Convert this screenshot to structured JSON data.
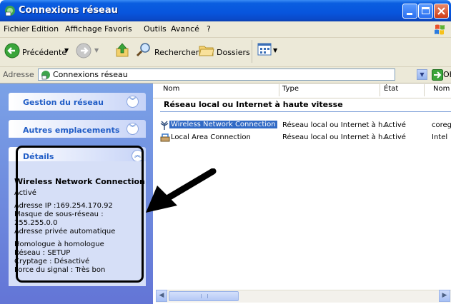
{
  "window": {
    "title": "Connexions réseau",
    "accent": "#0855dd",
    "close_color": "#cf3c16"
  },
  "menu": [
    "Fichier",
    "Edition",
    "Affichage",
    "Favoris",
    "Outils",
    "Avancé",
    "?"
  ],
  "toolbar": {
    "back_label": "Précédente",
    "search_label": "Rechercher",
    "folders_label": "Dossiers"
  },
  "address": {
    "label": "Adresse",
    "value": "Connexions réseau",
    "go_label": "OK"
  },
  "left_pane": {
    "network_tasks": "Gestion du réseau",
    "other_places": "Autres emplacements",
    "details_title": "Détails",
    "details": {
      "name": "Wireless Network Connection",
      "status": "Activé",
      "ip": "Adresse IP :169.254.170.92",
      "mask_label": "Masque de sous-réseau :",
      "mask": "255.255.0.0",
      "address_type": "Adresse privée automatique",
      "mode": "Homologue à homologue",
      "network": "Réseau : SETUP",
      "encryption": "Cryptage : Désactivé",
      "signal": "Force du signal : Très bon"
    }
  },
  "list": {
    "columns": [
      "Nom",
      "Type",
      "État",
      "Nom"
    ],
    "group_title": "Réseau local ou Internet à haute vitesse",
    "rows": [
      {
        "name": "Wireless Network Connection",
        "type": "Réseau local ou Internet à h...",
        "status": "Activé",
        "device": "coreg"
      },
      {
        "name": "Local Area Connection",
        "type": "Réseau local ou Internet à h...",
        "status": "Activé",
        "device": "Intel"
      }
    ]
  }
}
